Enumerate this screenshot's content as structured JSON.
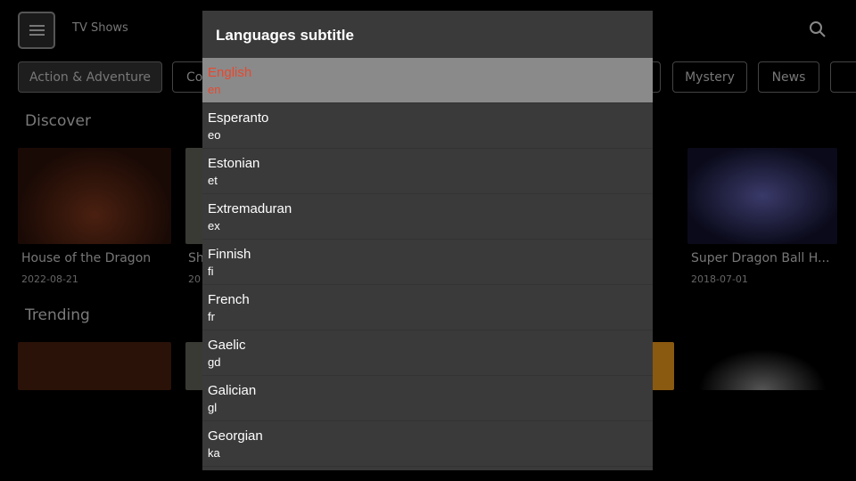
{
  "header": {
    "title": "TV Shows",
    "menu_icon": "hamburger-icon",
    "search_icon": "search-icon"
  },
  "genres": [
    "Action & Adventure",
    "Co",
    "Mystery",
    "News"
  ],
  "discover": {
    "label": "Discover",
    "items": [
      {
        "title": "House of the Dragon",
        "date": "2022-08-21"
      },
      {
        "title": "Sh",
        "date": "20"
      },
      {
        "title": "Super Dragon Ball H...",
        "date": "2018-07-01"
      }
    ]
  },
  "trending": {
    "label": "Trending"
  },
  "dialog": {
    "title": "Languages subtitle",
    "accent": "#e8482f",
    "languages": [
      {
        "name": "English",
        "code": "en",
        "selected": true
      },
      {
        "name": "Esperanto",
        "code": "eo"
      },
      {
        "name": "Estonian",
        "code": "et"
      },
      {
        "name": "Extremaduran",
        "code": "ex"
      },
      {
        "name": "Finnish",
        "code": "fi"
      },
      {
        "name": "French",
        "code": "fr"
      },
      {
        "name": "Gaelic",
        "code": "gd"
      },
      {
        "name": "Galician",
        "code": "gl"
      },
      {
        "name": "Georgian",
        "code": "ka"
      }
    ]
  }
}
